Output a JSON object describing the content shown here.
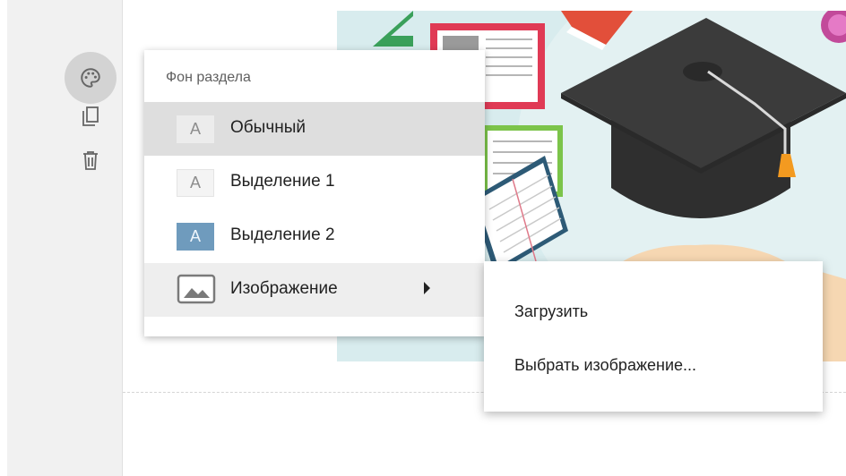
{
  "toolbar": {
    "buttons": [
      {
        "name": "palette",
        "icon": "palette-icon"
      },
      {
        "name": "duplicate",
        "icon": "copy-icon"
      },
      {
        "name": "delete",
        "icon": "trash-icon"
      }
    ],
    "active_bg": "#d3d3d3"
  },
  "background_menu": {
    "title": "Фон раздела",
    "items": [
      {
        "swatch_letter": "A",
        "label": "Обычный",
        "swatch_color": "#ececec",
        "highlighted": true
      },
      {
        "swatch_letter": "A",
        "label": "Выделение 1",
        "swatch_color": "#f4f4f4"
      },
      {
        "swatch_letter": "A",
        "label": "Выделение 2",
        "swatch_color": "#6f9bbd"
      },
      {
        "icon": "image-icon",
        "label": "Изображение",
        "has_submenu": true
      }
    ]
  },
  "image_submenu": {
    "items": [
      {
        "label": "Загрузить"
      },
      {
        "label": "Выбрать изображение..."
      }
    ]
  },
  "colors": {
    "toolbar_bg": "#f1f1f1",
    "image_bg": "#d8ecee",
    "accent_blue": "#6f9bbd"
  }
}
